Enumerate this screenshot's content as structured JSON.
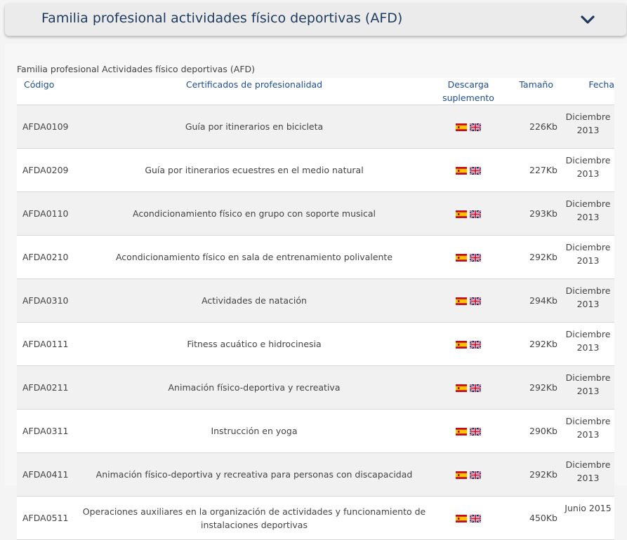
{
  "accordion": {
    "title": "Familia profesional actividades físico deportivas (AFD)"
  },
  "caption": "Familia profesional Actividades físico deportivas (AFD)",
  "columns": {
    "code": "Código",
    "title": "Certificados de profesionalidad",
    "download": "Descarga suplemento",
    "size": "Tamaño",
    "date": "Fecha"
  },
  "icons": {
    "expand": "chevron-down-icon",
    "spanish": "spanish-flag-icon",
    "english": "uk-flag-icon"
  },
  "colors": {
    "title": "#1e3a5f",
    "header": "#1e4f8f",
    "row_alt": "#f1f1f1"
  },
  "rows": [
    {
      "code": "AFDA0109",
      "title": "Guía por itinerarios en bicicleta",
      "size": "226Kb",
      "date": "Diciembre 2013"
    },
    {
      "code": "AFDA0209",
      "title": "Guía por itinerarios ecuestres en el medio natural",
      "size": "227Kb",
      "date": "Diciembre 2013"
    },
    {
      "code": "AFDA0110",
      "title": "Acondicionamiento físico en grupo con soporte musical",
      "size": "293Kb",
      "date": "Diciembre 2013"
    },
    {
      "code": "AFDA0210",
      "title": "Acondicionamiento físico en sala de entrenamiento polivalente",
      "size": "292Kb",
      "date": "Diciembre 2013"
    },
    {
      "code": "AFDA0310",
      "title": "Actividades de natación",
      "size": "294Kb",
      "date": "Diciembre 2013"
    },
    {
      "code": "AFDA0111",
      "title": "Fitness acuático e hidrocinesia",
      "size": "292Kb",
      "date": "Diciembre 2013"
    },
    {
      "code": "AFDA0211",
      "title": "Animación físico-deportiva y recreativa",
      "size": "292Kb",
      "date": "Diciembre 2013"
    },
    {
      "code": "AFDA0311",
      "title": "Instrucción en yoga",
      "size": "290Kb",
      "date": "Diciembre 2013"
    },
    {
      "code": "AFDA0411",
      "title": "Animación físico-deportiva y recreativa para personas con discapacidad",
      "size": "292Kb",
      "date": "Diciembre 2013"
    },
    {
      "code": "AFDA0511",
      "title": "Operaciones auxiliares en la organización de actividades y funcionamiento de instalaciones deportivas",
      "size": "450Kb",
      "date": "Junio 2015"
    }
  ]
}
